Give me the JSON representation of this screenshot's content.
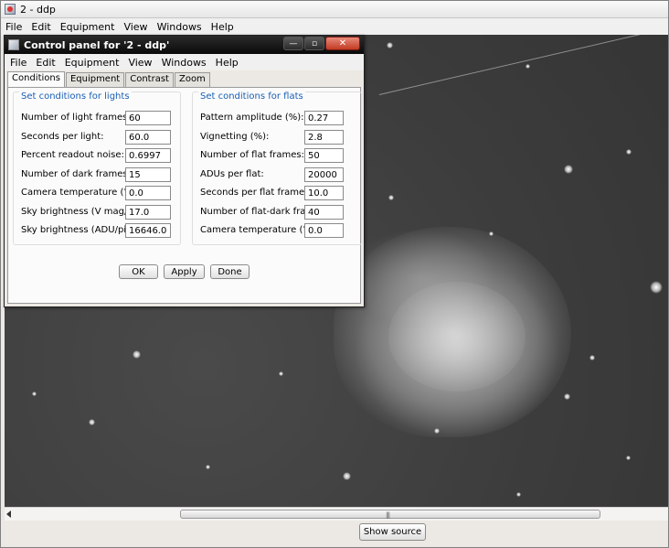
{
  "main": {
    "title": "2 - ddp",
    "menu": [
      "File",
      "Edit",
      "Equipment",
      "View",
      "Windows",
      "Help"
    ],
    "scroll_grip": "|||",
    "show_source_label": "Show source"
  },
  "dialog": {
    "title": "Control panel for '2 - ddp'",
    "menu": [
      "File",
      "Edit",
      "Equipment",
      "View",
      "Windows",
      "Help"
    ],
    "window_buttons": {
      "minimize": "—",
      "maximize": "▫",
      "close": "✕"
    },
    "tabs": [
      {
        "label": "Conditions",
        "active": true
      },
      {
        "label": "Equipment",
        "active": false
      },
      {
        "label": "Contrast",
        "active": false
      },
      {
        "label": "Zoom",
        "active": false
      }
    ],
    "lights": {
      "title": "Set conditions for lights",
      "fields": [
        {
          "label": "Number of light frames:",
          "value": "60"
        },
        {
          "label": "Seconds per light:",
          "value": "60.0"
        },
        {
          "label": "Percent readout noise:",
          "value": "0.6997"
        },
        {
          "label": "Number of dark frames:",
          "value": "15"
        },
        {
          "label": "Camera temperature (°C):",
          "value": "0.0"
        },
        {
          "label": "Sky brightness (V mag/sq\"):",
          "value": "17.0"
        },
        {
          "label": "Sky brightness (ADU/pixel):",
          "value": "16646.0"
        }
      ]
    },
    "flats": {
      "title": "Set conditions for flats",
      "fields": [
        {
          "label": "Pattern amplitude (%):",
          "value": "0.27"
        },
        {
          "label": "Vignetting (%):",
          "value": "2.8"
        },
        {
          "label": "Number of flat frames:",
          "value": "50"
        },
        {
          "label": "ADUs per flat:",
          "value": "20000"
        },
        {
          "label": "Seconds per flat frame:",
          "value": "10.0"
        },
        {
          "label": "Number of flat-dark frames:",
          "value": "40"
        },
        {
          "label": "Camera temperature (°C):",
          "value": "0.0"
        }
      ]
    },
    "buttons": {
      "ok": "OK",
      "apply": "Apply",
      "done": "Done"
    }
  },
  "colors": {
    "group_title": "#1a5fb4",
    "dialog_titlebar": "#0a0a0a",
    "close_button": "#c23a22"
  }
}
